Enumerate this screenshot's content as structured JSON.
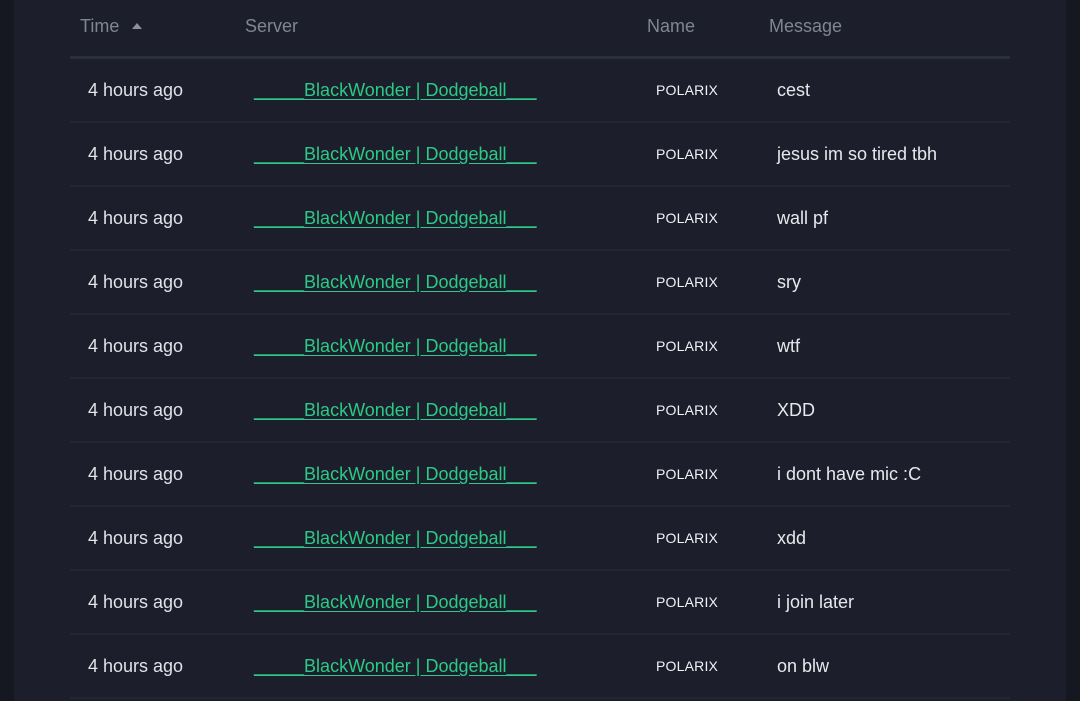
{
  "colors": {
    "background": "#151821",
    "panel": "#1c1f2b",
    "link": "#2dc986",
    "header_text": "#7f8593",
    "row_text": "#dfe2e8"
  },
  "table": {
    "headers": {
      "time": "Time",
      "server": "Server",
      "name": "Name",
      "message": "Message"
    },
    "sort_icon": "sort-ascending-icon",
    "rows": [
      {
        "time": "4 hours ago",
        "server": "_____BlackWonder | Dodgeball___",
        "name": "POLARIX",
        "message": "cest"
      },
      {
        "time": "4 hours ago",
        "server": "_____BlackWonder | Dodgeball___",
        "name": "POLARIX",
        "message": "jesus im so tired tbh"
      },
      {
        "time": "4 hours ago",
        "server": "_____BlackWonder | Dodgeball___",
        "name": "POLARIX",
        "message": "wall pf"
      },
      {
        "time": "4 hours ago",
        "server": "_____BlackWonder | Dodgeball___",
        "name": "POLARIX",
        "message": "sry"
      },
      {
        "time": "4 hours ago",
        "server": "_____BlackWonder | Dodgeball___",
        "name": "POLARIX",
        "message": "wtf"
      },
      {
        "time": "4 hours ago",
        "server": "_____BlackWonder | Dodgeball___",
        "name": "POLARIX",
        "message": "XDD"
      },
      {
        "time": "4 hours ago",
        "server": "_____BlackWonder | Dodgeball___",
        "name": "POLARIX",
        "message": "i dont have mic :C"
      },
      {
        "time": "4 hours ago",
        "server": "_____BlackWonder | Dodgeball___",
        "name": "POLARIX",
        "message": "xdd"
      },
      {
        "time": "4 hours ago",
        "server": "_____BlackWonder | Dodgeball___",
        "name": "POLARIX",
        "message": "i join later"
      },
      {
        "time": "4 hours ago",
        "server": "_____BlackWonder | Dodgeball___",
        "name": "POLARIX",
        "message": "on blw"
      }
    ]
  }
}
